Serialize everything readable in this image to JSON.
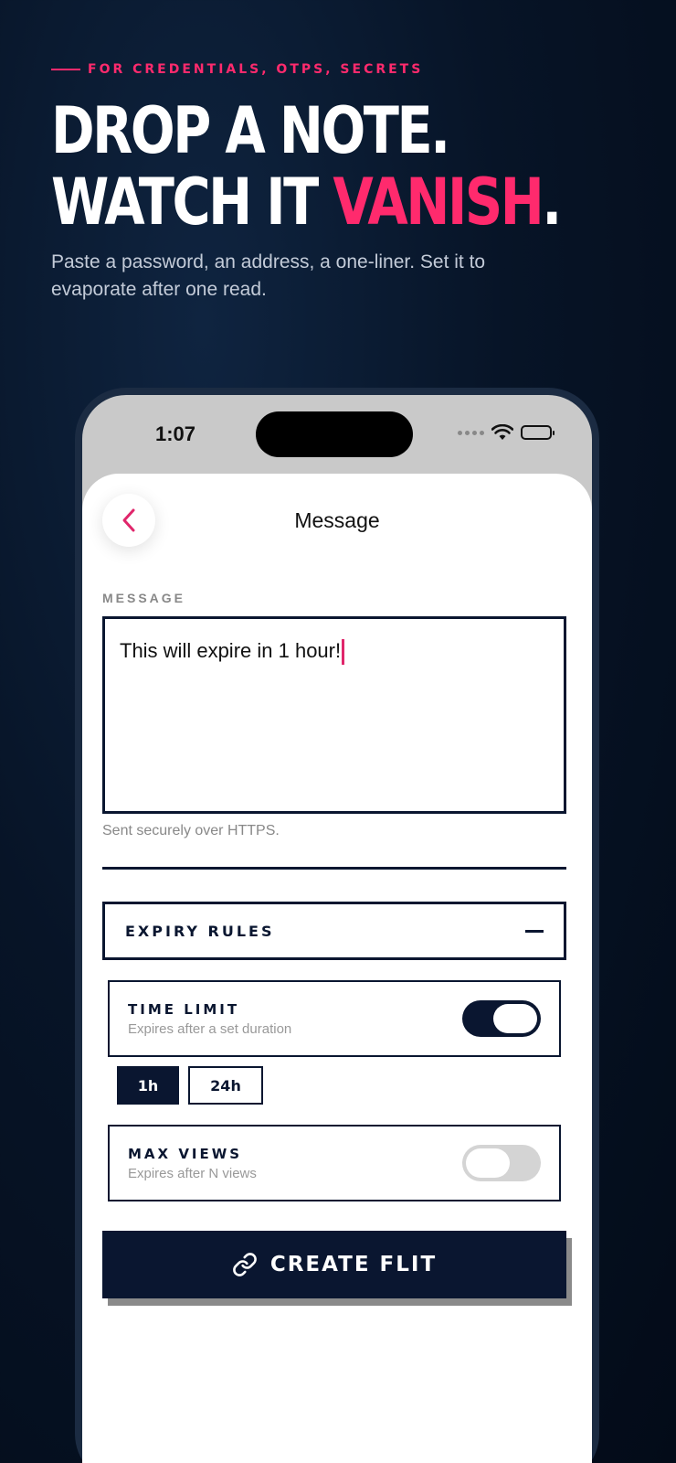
{
  "hero": {
    "eyebrow": "FOR CREDENTIALS, OTPS, SECRETS",
    "headline_line1": "DROP A NOTE.",
    "headline_line2_prefix": "WATCH IT ",
    "headline_accent": "VANISH",
    "headline_suffix": ".",
    "subcopy": "Paste a password, an address, a one-liner. Set it to evaporate after one read."
  },
  "status_bar": {
    "time": "1:07"
  },
  "nav": {
    "title": "Message"
  },
  "form": {
    "message_label": "MESSAGE",
    "message_value": "This will expire in 1 hour!",
    "helper_text": "Sent securely over HTTPS."
  },
  "expiry": {
    "title": "EXPIRY RULES",
    "time_limit": {
      "title": "TIME LIMIT",
      "desc": "Expires after a set duration",
      "enabled": true
    },
    "durations": [
      "1h",
      "24h"
    ],
    "selected_duration": "1h",
    "max_views": {
      "title": "MAX VIEWS",
      "desc": "Expires after N views",
      "enabled": false
    }
  },
  "cta": {
    "label": "CREATE FLIT"
  },
  "colors": {
    "accent": "#ff2a6d",
    "navy": "#0a1630",
    "background": "#071427"
  }
}
